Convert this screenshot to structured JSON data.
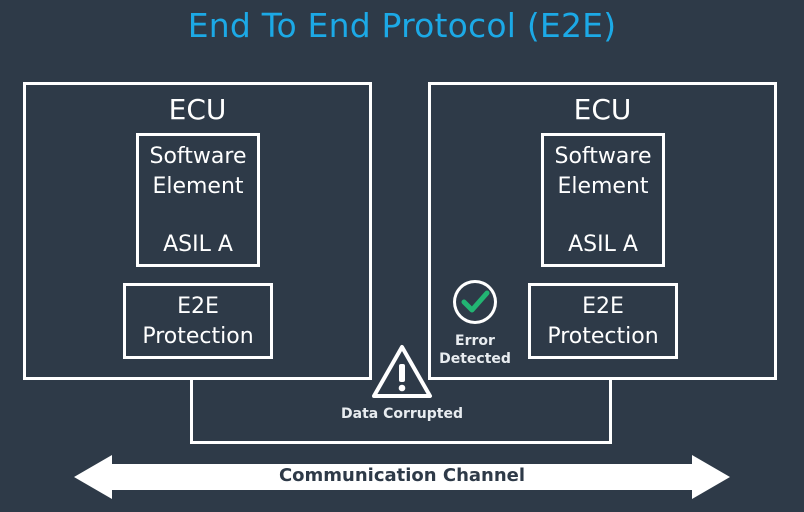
{
  "title": "End To End Protocol (E2E)",
  "ecus": [
    {
      "label": "ECU",
      "software_element": {
        "name": "Software Element",
        "asil": "ASIL A"
      },
      "e2e": {
        "line1": "E2E",
        "line2": "Protection"
      }
    },
    {
      "label": "ECU",
      "software_element": {
        "name": "Software Element",
        "asil": "ASIL A"
      },
      "e2e": {
        "line1": "E2E",
        "line2": "Protection"
      }
    }
  ],
  "status": {
    "error_line1": "Error",
    "error_line2": "Detected",
    "corrupted": "Data Corrupted"
  },
  "channel": {
    "label": "Communication Channel"
  },
  "icons": {
    "check": "check-circle-icon",
    "warning": "warning-triangle-icon",
    "arrow": "double-arrow-icon"
  },
  "colors": {
    "background": "#2e3a48",
    "title": "#1ca9e6",
    "check": "#22b573",
    "lines": "#ffffff"
  }
}
